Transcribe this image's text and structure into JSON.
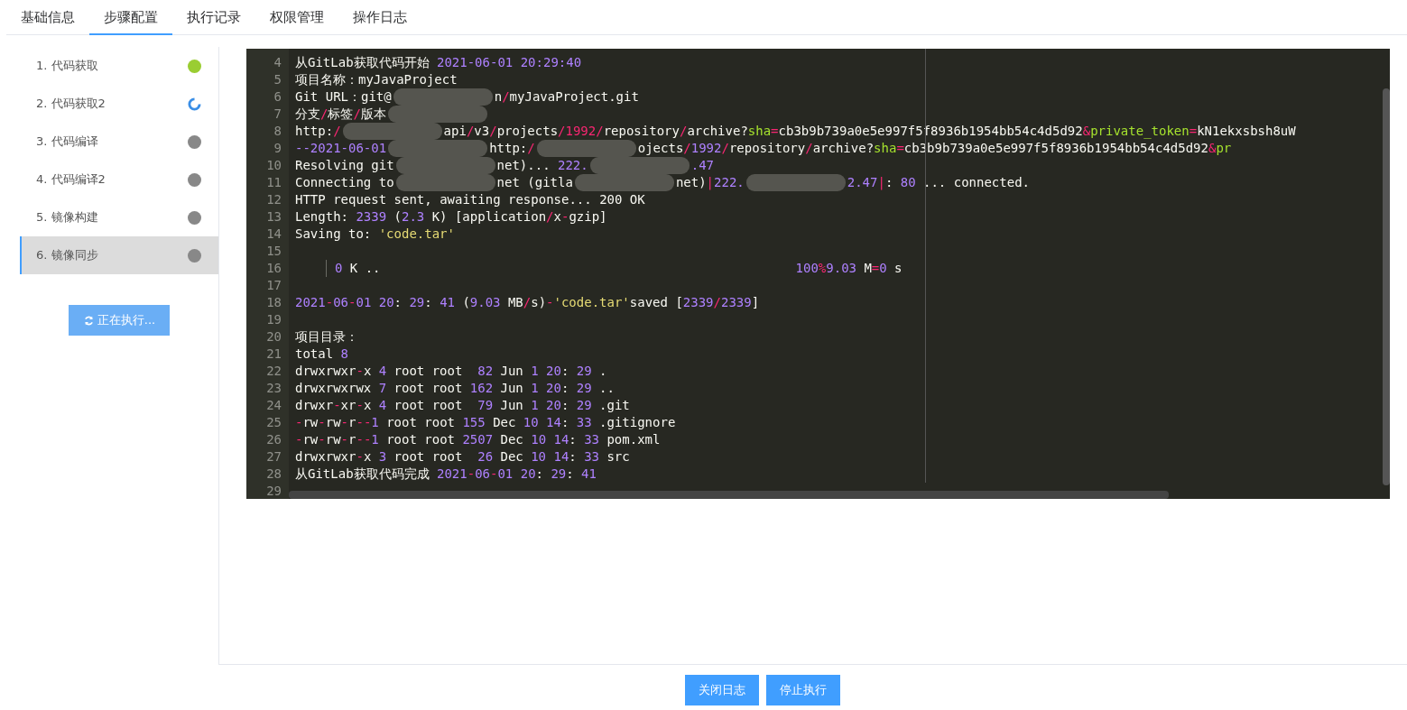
{
  "tabs": [
    {
      "label": "基础信息",
      "selected": false
    },
    {
      "label": "步骤配置",
      "selected": true
    },
    {
      "label": "执行记录",
      "selected": false
    },
    {
      "label": "权限管理",
      "selected": false
    },
    {
      "label": "操作日志",
      "selected": false
    }
  ],
  "steps": [
    {
      "label": "1. 代码获取",
      "kind": "done",
      "selected": false
    },
    {
      "label": "2. 代码获取2",
      "kind": "running",
      "selected": false
    },
    {
      "label": "3. 代码编译",
      "kind": "pending",
      "selected": false
    },
    {
      "label": "4. 代码编译2",
      "kind": "pending",
      "selected": false
    },
    {
      "label": "5. 镜像构建",
      "kind": "pending",
      "selected": false
    },
    {
      "label": "6. 镜像同步",
      "kind": "pending",
      "selected": true
    }
  ],
  "run_button": {
    "label": "正在执行...",
    "disabled": true
  },
  "log": [
    {
      "n": "4",
      "parts": [
        {
          "t": "从GitLab获取代码开始",
          "kind": "text"
        },
        {
          "t": "2021-06-01 20:29:40",
          "kind": "num"
        }
      ]
    },
    {
      "n": "5",
      "parts": [
        {
          "t": "项目名称：myJavaProject",
          "kind": "text"
        }
      ]
    },
    {
      "n": "6",
      "parts": [
        {
          "t": "Git URL：git@",
          "kind": "text"
        },
        {
          "kind": "blur"
        },
        {
          "t": "n",
          "kind": "text"
        },
        {
          "t": "/",
          "kind": "punct"
        },
        {
          "t": "myJavaProject.git",
          "kind": "text"
        }
      ]
    },
    {
      "n": "7",
      "parts": [
        {
          "t": "分支",
          "kind": "text"
        },
        {
          "t": "/",
          "kind": "punct"
        },
        {
          "t": "标签",
          "kind": "text"
        },
        {
          "t": "/",
          "kind": "punct"
        },
        {
          "t": "版本",
          "kind": "text"
        },
        {
          "kind": "blur"
        }
      ]
    },
    {
      "n": "8",
      "parts": [
        {
          "t": "http:",
          "kind": "text"
        },
        {
          "t": "/",
          "kind": "punct"
        },
        {
          "kind": "blur"
        },
        {
          "t": "api",
          "kind": "text"
        },
        {
          "t": "/",
          "kind": "punct"
        },
        {
          "t": "v3",
          "kind": "text"
        },
        {
          "t": "/",
          "kind": "punct"
        },
        {
          "t": "projects",
          "kind": "text"
        },
        {
          "t": "/1992/",
          "kind": "punct"
        },
        {
          "t": "repository",
          "kind": "text"
        },
        {
          "t": "/",
          "kind": "punct"
        },
        {
          "t": "archive?",
          "kind": "text"
        },
        {
          "t": "sha",
          "kind": "key"
        },
        {
          "t": "=",
          "kind": "punct"
        },
        {
          "t": "cb3b9b739a0e5e997f5f8936b1954bb54c4d5d92",
          "kind": "text"
        },
        {
          "t": "&",
          "kind": "punct"
        },
        {
          "t": "private_token",
          "kind": "key"
        },
        {
          "t": "=",
          "kind": "punct"
        },
        {
          "t": "kN1ekxsbsh8uW",
          "kind": "text"
        }
      ]
    },
    {
      "n": "9",
      "parts": [
        {
          "t": "--2021-06-01",
          "kind": "num"
        },
        {
          "kind": "blur"
        },
        {
          "t": "http:",
          "kind": "text"
        },
        {
          "t": "/",
          "kind": "punct"
        },
        {
          "kind": "blur"
        },
        {
          "t": "ojects",
          "kind": "text"
        },
        {
          "t": "/",
          "kind": "punct"
        },
        {
          "t": "1992",
          "kind": "num"
        },
        {
          "t": "/",
          "kind": "punct"
        },
        {
          "t": "repository",
          "kind": "text"
        },
        {
          "t": "/",
          "kind": "punct"
        },
        {
          "t": "archive?",
          "kind": "text"
        },
        {
          "t": "sha",
          "kind": "key"
        },
        {
          "t": "=",
          "kind": "punct"
        },
        {
          "t": "cb3b9b739a0e5e997f5f8936b1954bb54c4d5d92",
          "kind": "text"
        },
        {
          "t": "&",
          "kind": "punct"
        },
        {
          "t": "pr",
          "kind": "key"
        }
      ]
    },
    {
      "n": "10",
      "parts": [
        {
          "t": "Resolving git",
          "kind": "text"
        },
        {
          "kind": "blur"
        },
        {
          "t": "net)...",
          "kind": "text"
        },
        {
          "t": "222.",
          "kind": "num"
        },
        {
          "kind": "blur"
        },
        {
          "t": ".47",
          "kind": "num"
        }
      ]
    },
    {
      "n": "11",
      "parts": [
        {
          "t": "Connecting to",
          "kind": "text"
        },
        {
          "kind": "blur"
        },
        {
          "t": "net (gitla",
          "kind": "text"
        },
        {
          "kind": "blur"
        },
        {
          "t": "net)",
          "kind": "text"
        },
        {
          "t": "|",
          "kind": "punct"
        },
        {
          "t": "222.",
          "kind": "num"
        },
        {
          "kind": "blur"
        },
        {
          "t": "2.47",
          "kind": "num"
        },
        {
          "t": "|",
          "kind": "punct"
        },
        {
          "t": ":",
          "kind": "text"
        },
        {
          "t": "80",
          "kind": "num"
        },
        {
          "t": "... connected.",
          "kind": "text"
        }
      ]
    },
    {
      "n": "12",
      "parts": [
        {
          "t": "HTTP request sent, awaiting response... 200 OK",
          "kind": "text"
        }
      ]
    },
    {
      "n": "13",
      "parts": [
        {
          "t": "Length:",
          "kind": "text"
        },
        {
          "t": "2339",
          "kind": "num"
        },
        {
          "t": "(",
          "kind": "text"
        },
        {
          "t": "2.3",
          "kind": "num"
        },
        {
          "t": "K) [application",
          "kind": "text"
        },
        {
          "t": "/",
          "kind": "punct"
        },
        {
          "t": "x",
          "kind": "text"
        },
        {
          "t": "-",
          "kind": "punct"
        },
        {
          "t": "gzip]",
          "kind": "text"
        }
      ]
    },
    {
      "n": "14",
      "parts": [
        {
          "t": "Saving to:",
          "kind": "text"
        },
        {
          "t": "'code.tar'",
          "kind": "str"
        }
      ]
    },
    {
      "n": "15"
    },
    {
      "n": "16",
      "indent": true,
      "parts": [
        {
          "t": "0",
          "kind": "num"
        },
        {
          "t": "K ..",
          "kind": "text"
        },
        {
          "kind": "tab"
        },
        {
          "t": "100",
          "kind": "num"
        },
        {
          "t": "%",
          "kind": "punct"
        },
        {
          "t": "9.03",
          "kind": "num"
        },
        {
          "t": "M",
          "kind": "text"
        },
        {
          "t": "=",
          "kind": "punct"
        },
        {
          "t": "0",
          "kind": "num"
        },
        {
          "t": "s",
          "kind": "text"
        }
      ]
    },
    {
      "n": "17"
    },
    {
      "n": "18",
      "parts": [
        {
          "t": "2021",
          "kind": "num"
        },
        {
          "t": "-",
          "kind": "punct"
        },
        {
          "t": "06",
          "kind": "num"
        },
        {
          "t": "-",
          "kind": "punct"
        },
        {
          "t": "01 20",
          "kind": "num"
        },
        {
          "t": ":",
          "kind": "text"
        },
        {
          "t": "29",
          "kind": "num"
        },
        {
          "t": ":",
          "kind": "text"
        },
        {
          "t": "41",
          "kind": "num"
        },
        {
          "t": "(",
          "kind": "text"
        },
        {
          "t": "9.03",
          "kind": "num"
        },
        {
          "t": "MB",
          "kind": "text"
        },
        {
          "t": "/",
          "kind": "punct"
        },
        {
          "t": "s)",
          "kind": "text"
        },
        {
          "t": "-",
          "kind": "punct"
        },
        {
          "t": "'code.tar'",
          "kind": "str"
        },
        {
          "t": "saved [",
          "kind": "text"
        },
        {
          "t": "2339",
          "kind": "num"
        },
        {
          "t": "/",
          "kind": "punct"
        },
        {
          "t": "2339",
          "kind": "num"
        },
        {
          "t": "]",
          "kind": "text"
        }
      ]
    },
    {
      "n": "19"
    },
    {
      "n": "20",
      "parts": [
        {
          "t": "项目目录：",
          "kind": "text"
        }
      ]
    },
    {
      "n": "21",
      "parts": [
        {
          "t": "total",
          "kind": "text"
        },
        {
          "t": "8",
          "kind": "num"
        }
      ]
    },
    {
      "n": "22",
      "parts": [
        {
          "t": "drwxrwxr",
          "kind": "text"
        },
        {
          "t": "-",
          "kind": "punct"
        },
        {
          "t": "x",
          "kind": "text"
        },
        {
          "t": "4",
          "kind": "num"
        },
        {
          "t": "root root",
          "kind": "text"
        },
        {
          "t": "  82",
          "kind": "num"
        },
        {
          "t": "Jun",
          "kind": "text"
        },
        {
          "t": " 1 20",
          "kind": "num"
        },
        {
          "t": ":",
          "kind": "text"
        },
        {
          "t": "29",
          "kind": "num"
        },
        {
          "t": ".",
          "kind": "text"
        }
      ]
    },
    {
      "n": "23",
      "parts": [
        {
          "t": "drwxrwxrwx",
          "kind": "text"
        },
        {
          "t": "7",
          "kind": "num"
        },
        {
          "t": "root root",
          "kind": "text"
        },
        {
          "t": " 162",
          "kind": "num"
        },
        {
          "t": "Jun",
          "kind": "text"
        },
        {
          "t": " 1 20",
          "kind": "num"
        },
        {
          "t": ":",
          "kind": "text"
        },
        {
          "t": "29",
          "kind": "num"
        },
        {
          "t": "..",
          "kind": "text"
        }
      ]
    },
    {
      "n": "24",
      "parts": [
        {
          "t": "drwxr",
          "kind": "text"
        },
        {
          "t": "-",
          "kind": "punct"
        },
        {
          "t": "xr",
          "kind": "text"
        },
        {
          "t": "-",
          "kind": "punct"
        },
        {
          "t": "x",
          "kind": "text"
        },
        {
          "t": "4",
          "kind": "num"
        },
        {
          "t": "root root",
          "kind": "text"
        },
        {
          "t": "  79",
          "kind": "num"
        },
        {
          "t": "Jun",
          "kind": "text"
        },
        {
          "t": " 1 20",
          "kind": "num"
        },
        {
          "t": ":",
          "kind": "text"
        },
        {
          "t": "29",
          "kind": "num"
        },
        {
          "t": ".git",
          "kind": "text"
        }
      ]
    },
    {
      "n": "25",
      "parts": [
        {
          "t": "-",
          "kind": "punct"
        },
        {
          "t": "rw",
          "kind": "text"
        },
        {
          "t": "-",
          "kind": "punct"
        },
        {
          "t": "rw",
          "kind": "text"
        },
        {
          "t": "-",
          "kind": "punct"
        },
        {
          "t": "r",
          "kind": "text"
        },
        {
          "t": "--",
          "kind": "punct"
        },
        {
          "t": "1",
          "kind": "num"
        },
        {
          "t": "root root",
          "kind": "text"
        },
        {
          "t": " 155",
          "kind": "num"
        },
        {
          "t": "Dec",
          "kind": "text"
        },
        {
          "t": "10 14",
          "kind": "num"
        },
        {
          "t": ":",
          "kind": "text"
        },
        {
          "t": "33",
          "kind": "num"
        },
        {
          "t": ".gitignore",
          "kind": "text"
        }
      ]
    },
    {
      "n": "26",
      "parts": [
        {
          "t": "-",
          "kind": "punct"
        },
        {
          "t": "rw",
          "kind": "text"
        },
        {
          "t": "-",
          "kind": "punct"
        },
        {
          "t": "rw",
          "kind": "text"
        },
        {
          "t": "-",
          "kind": "punct"
        },
        {
          "t": "r",
          "kind": "text"
        },
        {
          "t": "--",
          "kind": "punct"
        },
        {
          "t": "1",
          "kind": "num"
        },
        {
          "t": "root root",
          "kind": "text"
        },
        {
          "t": "2507",
          "kind": "num"
        },
        {
          "t": "Dec",
          "kind": "text"
        },
        {
          "t": "10 14",
          "kind": "num"
        },
        {
          "t": ":",
          "kind": "text"
        },
        {
          "t": "33",
          "kind": "num"
        },
        {
          "t": "pom.xml",
          "kind": "text"
        }
      ]
    },
    {
      "n": "27",
      "parts": [
        {
          "t": "drwxrwxr",
          "kind": "text"
        },
        {
          "t": "-",
          "kind": "punct"
        },
        {
          "t": "x",
          "kind": "text"
        },
        {
          "t": "3",
          "kind": "num"
        },
        {
          "t": "root root",
          "kind": "text"
        },
        {
          "t": "  26",
          "kind": "num"
        },
        {
          "t": "Dec",
          "kind": "text"
        },
        {
          "t": "10 14",
          "kind": "num"
        },
        {
          "t": ":",
          "kind": "text"
        },
        {
          "t": "33",
          "kind": "num"
        },
        {
          "t": "src",
          "kind": "text"
        }
      ]
    },
    {
      "n": "28",
      "parts": [
        {
          "t": "从GitLab获取代码完成",
          "kind": "text"
        },
        {
          "t": "2021",
          "kind": "num"
        },
        {
          "t": "-",
          "kind": "punct"
        },
        {
          "t": "06",
          "kind": "num"
        },
        {
          "t": "-",
          "kind": "punct"
        },
        {
          "t": "01 20",
          "kind": "num"
        },
        {
          "t": ":",
          "kind": "text"
        },
        {
          "t": "29",
          "kind": "num"
        },
        {
          "t": ":",
          "kind": "text"
        },
        {
          "t": "41",
          "kind": "num"
        }
      ]
    },
    {
      "n": "29"
    }
  ],
  "buttons": [
    {
      "label": "关闭日志"
    },
    {
      "label": "停止执行"
    }
  ]
}
